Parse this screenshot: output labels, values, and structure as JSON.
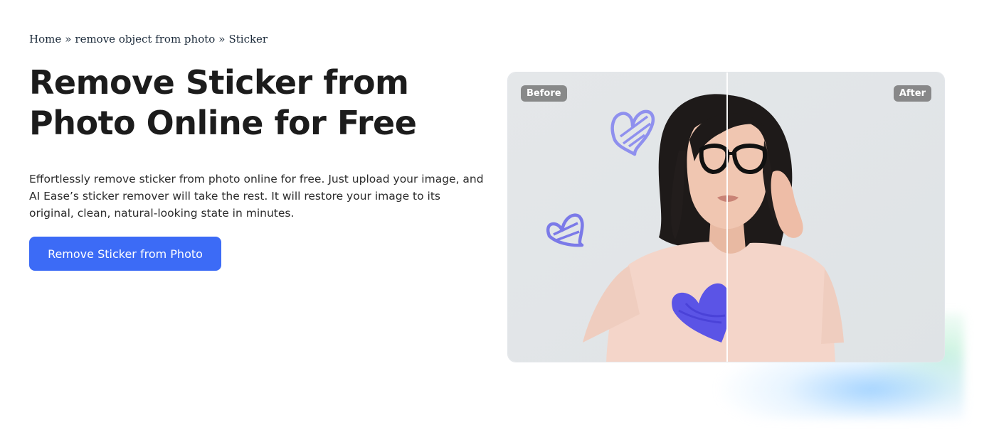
{
  "breadcrumb": {
    "items": [
      "Home",
      "remove object from photo",
      "Sticker"
    ],
    "separator": "»"
  },
  "hero": {
    "title": "Remove Sticker from Photo Online for Free",
    "description": "Effortlessly remove sticker from photo online for free. Just upload your image, and AI Ease’s sticker remover will take the rest. It will restore your image to its original, clean, natural-looking state in minutes.",
    "cta_label": "Remove Sticker from Photo"
  },
  "comparison": {
    "before_label": "Before",
    "after_label": "After"
  },
  "colors": {
    "accent": "#3c6bf6",
    "heading": "#1c1c1c",
    "sticker_light": "#8f90ee",
    "sticker_dark": "#5b54e6"
  }
}
